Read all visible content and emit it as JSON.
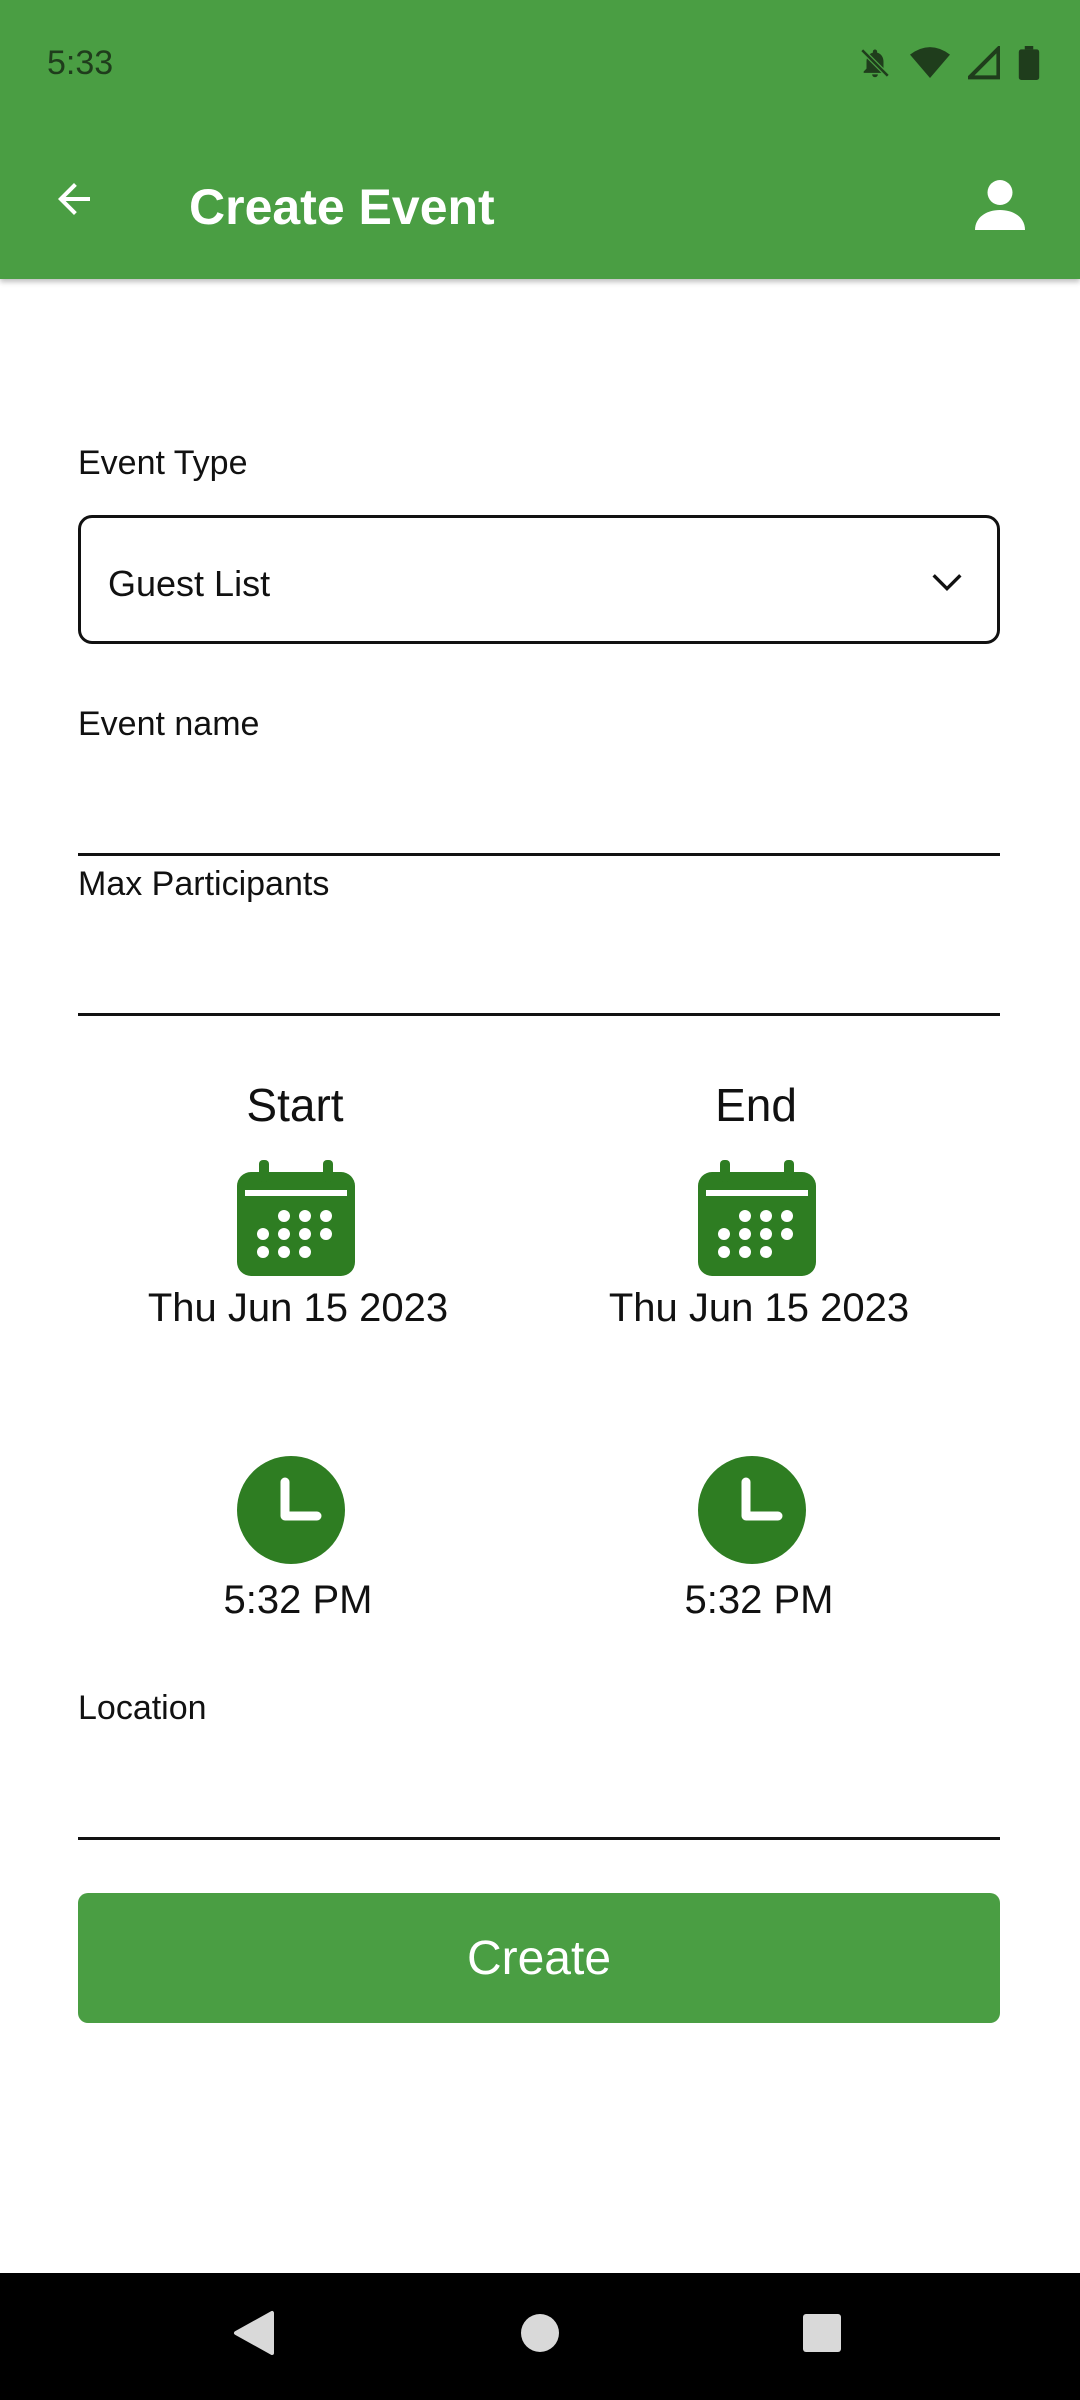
{
  "status_bar": {
    "time": "5:33",
    "icons": [
      "notifications-off-icon",
      "wifi-icon",
      "signal-icon",
      "battery-icon"
    ]
  },
  "app_bar": {
    "title": "Create Event",
    "back_icon": "arrow-left-icon",
    "profile_icon": "person-icon",
    "color": "#4a9e43"
  },
  "form": {
    "event_type": {
      "label": "Event Type",
      "value": "Guest List"
    },
    "event_name": {
      "label": "Event name",
      "value": ""
    },
    "max_participants": {
      "label": "Max Participants",
      "value": ""
    },
    "start": {
      "title": "Start",
      "date": "Thu Jun 15 2023",
      "time": "5:32 PM"
    },
    "end": {
      "title": "End",
      "date": "Thu Jun 15 2023",
      "time": "5:32 PM"
    },
    "location": {
      "label": "Location",
      "value": ""
    },
    "submit_label": "Create"
  },
  "icon_color": "#2e7d22",
  "nav_bar": {
    "items": [
      "back-triangle-icon",
      "home-circle-icon",
      "recents-square-icon"
    ]
  }
}
